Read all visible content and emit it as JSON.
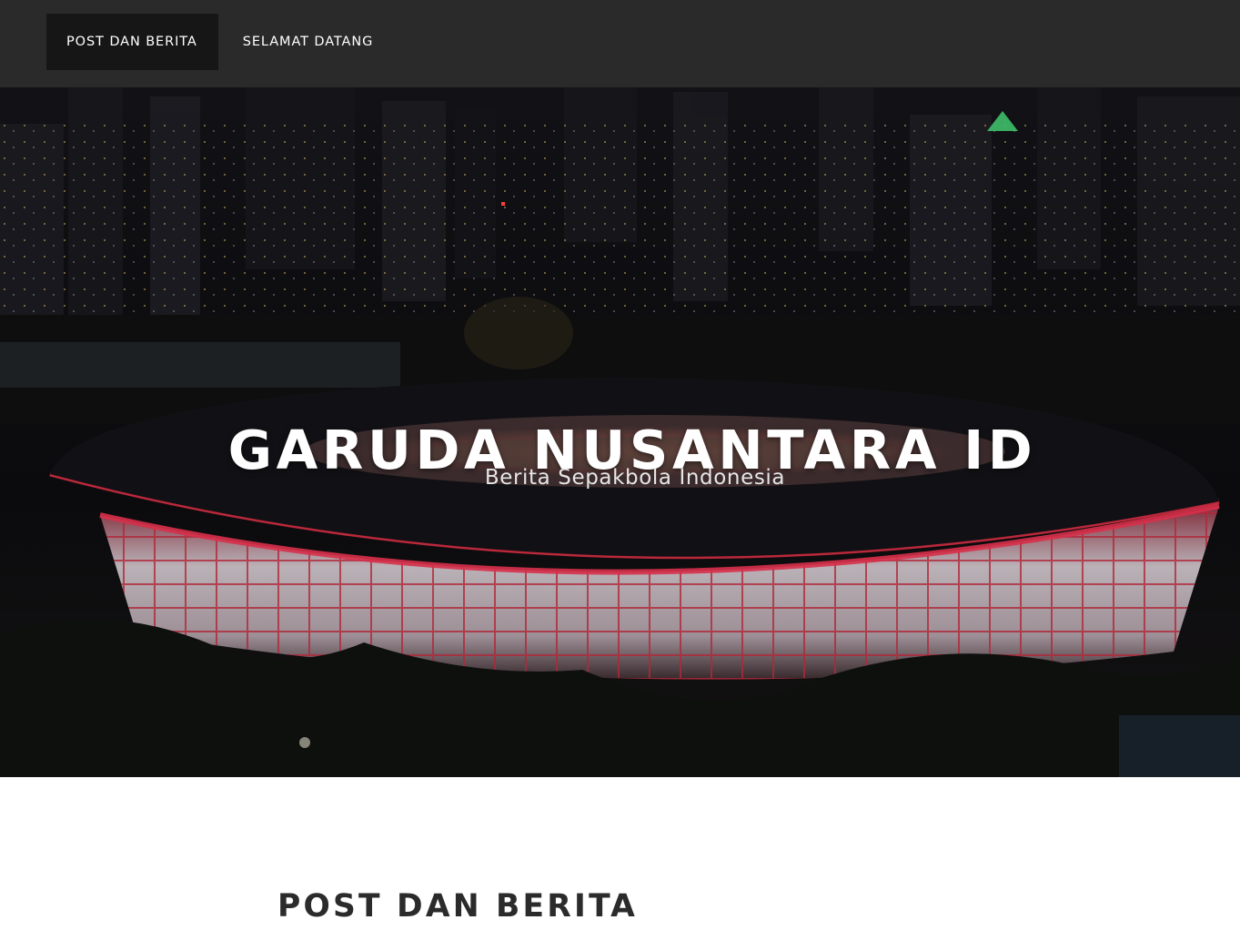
{
  "nav": {
    "items": [
      {
        "label": "POST DAN BERITA",
        "active": true
      },
      {
        "label": "SELAMAT DATANG",
        "active": false
      }
    ]
  },
  "hero": {
    "title": "GARUDA NUSANTARA ID",
    "subtitle": "Berita Sepakbola Indonesia"
  },
  "main": {
    "section_title": "POST DAN BERITA"
  },
  "colors": {
    "topbar": "#2a2a2a",
    "nav_active": "#161616",
    "stadium_red": "#c42a3e",
    "heading_dark": "#2b2b2b"
  }
}
